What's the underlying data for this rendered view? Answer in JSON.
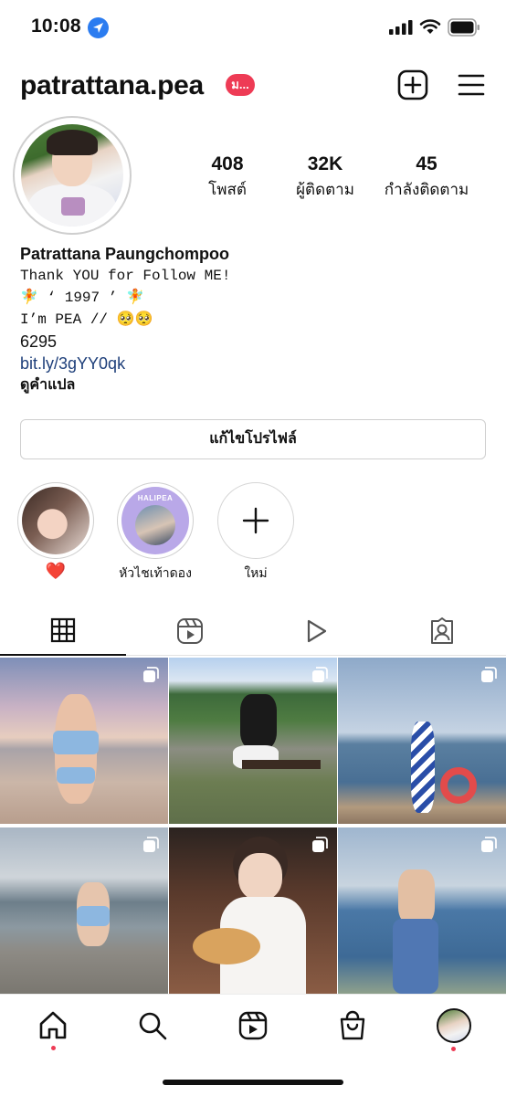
{
  "status_bar": {
    "time": "10:08"
  },
  "header": {
    "username": "patrattana.pea",
    "badge": "ม..."
  },
  "stats": [
    {
      "value": "408",
      "label": "โพสต์"
    },
    {
      "value": "32K",
      "label": "ผู้ติดตาม"
    },
    {
      "value": "45",
      "label": "กำลังติดตาม"
    }
  ],
  "bio": {
    "name": "Patrattana Paungchompoo",
    "line1": "Thank YOU for Follow ME!",
    "line2": "🧚 ‘ 1997 ’ 🧚",
    "line3": "I’m PEA // 🥺🥺",
    "line4": "6295",
    "link": "bit.ly/3gYY0qk",
    "translate": "ดูคำแปล"
  },
  "edit_profile_label": "แก้ไขโปรไฟล์",
  "highlights": [
    {
      "label": "❤️"
    },
    {
      "label": "หัวไชเท้าดอง",
      "cover_text": "HALIPEA"
    },
    {
      "label": "ใหม่"
    }
  ],
  "colors": {
    "accent_red": "#ee3b55",
    "link_blue": "#1e3f7a",
    "location_blue": "#2b7cf0"
  }
}
